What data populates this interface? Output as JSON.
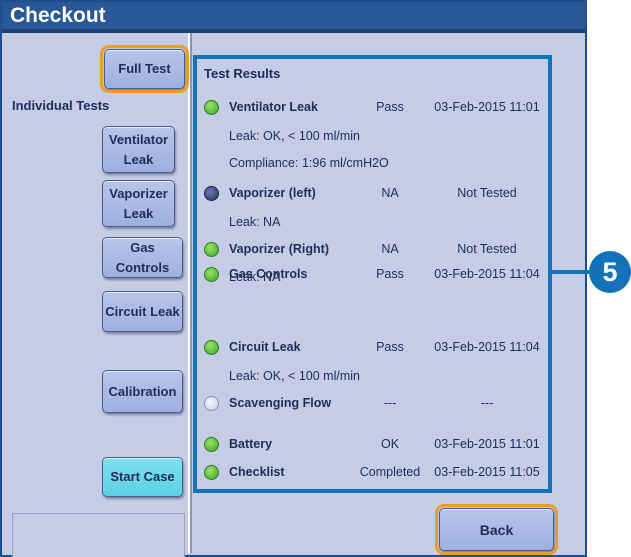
{
  "window": {
    "title": "Checkout"
  },
  "left": {
    "full_test": "Full Test",
    "individual_tests_label": "Individual Tests",
    "ventilator_leak": "Ventilator\nLeak",
    "vaporizer_leak": "Vaporizer\nLeak",
    "gas_controls": "Gas Controls",
    "circuit_leak": "Circuit Leak",
    "calibration": "Calibration",
    "start_case": "Start Case"
  },
  "results": {
    "title": "Test Results",
    "rows": [
      {
        "name": "Ventilator Leak",
        "status": "Pass",
        "date": "03-Feb-2015 11:01",
        "indicator": "green"
      },
      {
        "name": "Vaporizer (left)",
        "status": "NA",
        "date": "Not Tested",
        "indicator": "navy"
      },
      {
        "name": "Vaporizer (Right)",
        "status": "NA",
        "date": "Not Tested",
        "indicator": "green"
      },
      {
        "name": "Gas Controls",
        "status": "Pass",
        "date": "03-Feb-2015 11:04",
        "indicator": "green"
      },
      {
        "name": "Circuit Leak",
        "status": "Pass",
        "date": "03-Feb-2015 11:04",
        "indicator": "green"
      },
      {
        "name": "Scavenging Flow",
        "status": "---",
        "date": "---",
        "indicator": "empty"
      },
      {
        "name": "Battery",
        "status": "OK",
        "date": "03-Feb-2015 11:01",
        "indicator": "green"
      },
      {
        "name": "Checklist",
        "status": "Completed",
        "date": "03-Feb-2015 11:05",
        "indicator": "green"
      }
    ],
    "details": {
      "vent_leak": "Leak: OK, < 100 ml/min",
      "vent_compliance": "Compliance: 1:96 ml/cmH2O",
      "vap_left_leak": "Leak: NA",
      "vap_right_leak": "Leak: NA",
      "circuit_leak": "Leak: OK, < 100 ml/min"
    }
  },
  "back": "Back",
  "callout": "5",
  "colors": {
    "title_bar": "#2a5896",
    "panel": "#c5cce6",
    "highlight_border": "#1473b8",
    "focus_outline": "#f39a26",
    "start_case": "#5bd1e4"
  }
}
